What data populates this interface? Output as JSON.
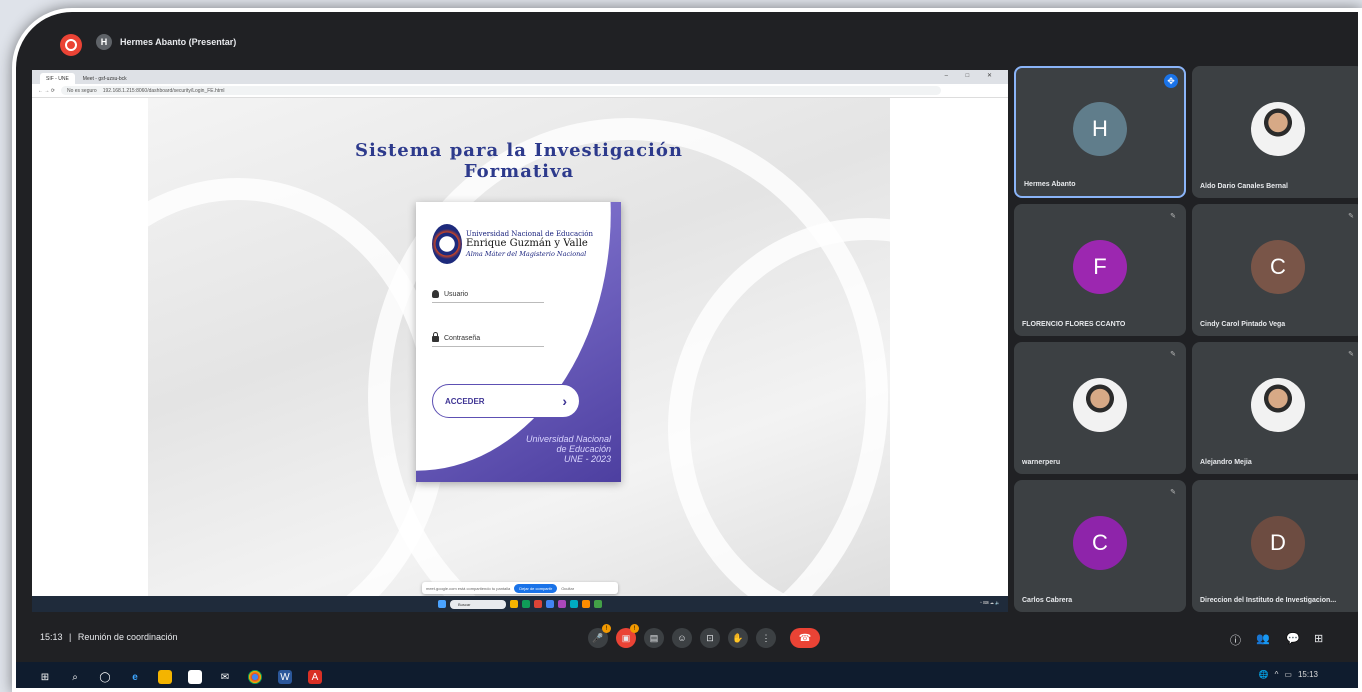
{
  "topbar": {
    "presenter_initial": "H",
    "presenter_label": "Hermes Abanto (Presentar)"
  },
  "browser": {
    "tabs": [
      "SIF - UNE",
      "Meet - gsf-uzsu-bck"
    ],
    "url_warning": "No es seguro",
    "url": "192.168.1.215:8060/dashboard/security/Login_FE.html"
  },
  "site": {
    "title_line1": "Sistema para la Investigación",
    "title_line2": "Formativa",
    "logo_line1": "Universidad Nacional de Educación",
    "logo_line2": "Enrique Guzmán y Valle",
    "logo_line3": "Alma Máter del Magisterio Nacional",
    "username_placeholder": "Usuario",
    "password_placeholder": "Contraseña",
    "login_button": "ACCEDER",
    "footer_line1": "Universidad Nacional",
    "footer_line2": "de Educación",
    "footer_line3": "UNE - 2023"
  },
  "share_bar": {
    "message": "meet.google.com está compartiendo tu pantalla",
    "stop": "Dejar de compartir",
    "hide": "Ocultar"
  },
  "inner_taskbar": {
    "search": "Buscar"
  },
  "participants": [
    {
      "name": "Hermes Abanto",
      "initial": "H",
      "color": "#607d8b"
    },
    {
      "name": "Aldo Dario Canales Bernal",
      "initial": "",
      "color": ""
    },
    {
      "name": "FLORENCIO FLORES CCANTO",
      "initial": "F",
      "color": "#9c27b0"
    },
    {
      "name": "Cindy Carol Pintado Vega",
      "initial": "C",
      "color": "#795548"
    },
    {
      "name": "warnerperu",
      "initial": "",
      "color": ""
    },
    {
      "name": "Alejandro Mejia",
      "initial": "",
      "color": ""
    },
    {
      "name": "Carlos Cabrera",
      "initial": "C",
      "color": "#8e24aa"
    },
    {
      "name": "Direccion del Instituto de Investigacion...",
      "initial": "D",
      "color": "#6d4c41"
    }
  ],
  "meeting": {
    "time": "15:13",
    "separator": "|",
    "title": "Reunión de coordinación"
  },
  "host_clock": "15:13"
}
